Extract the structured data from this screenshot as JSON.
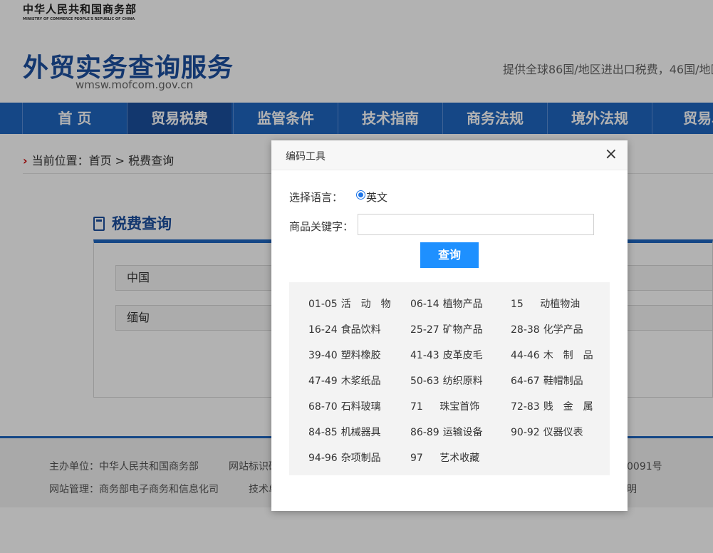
{
  "top": {
    "ministry_cn": "中华人民共和国商务部",
    "ministry_en": "MINISTRY OF COMMERCE PEOPLE'S REPUBLIC OF CHINA"
  },
  "header": {
    "title": "外贸实务查询服务",
    "url": "wmsw.mofcom.gov.cn",
    "slogan": "提供全球86国/地区进出口税费，46国/地区"
  },
  "nav": {
    "items": [
      "首 页",
      "贸易税费",
      "监管条件",
      "技术指南",
      "商务法规",
      "境外法规",
      "贸易单"
    ],
    "active_index": 1
  },
  "breadcrumb": {
    "text": "当前位置：首页 > 税费查询"
  },
  "tax": {
    "title": "税费查询",
    "field_from": "中国",
    "field_to": "缅甸"
  },
  "footer": {
    "row1_a": "主办单位：中华人民共和国商务部",
    "row1_b": "网站标识码",
    "row1_c": "0091号",
    "row2_a": "网站管理：商务部电子商务和信息化司",
    "row2_b": "技术单",
    "row2_c": "明"
  },
  "modal": {
    "title": "编码工具",
    "close": "×",
    "lang_label": "选择语言：",
    "lang_option": "英文",
    "keyword_label": "商品关键字：",
    "keyword_value": "",
    "query_button": "查询",
    "categories": [
      {
        "code": "01-05",
        "name": "活　动　物"
      },
      {
        "code": "06-14",
        "name": "植物产品"
      },
      {
        "code": "15",
        "name": "　  动植物油"
      },
      {
        "code": "16-24",
        "name": "食品饮料"
      },
      {
        "code": "25-27",
        "name": "矿物产品"
      },
      {
        "code": "28-38",
        "name": "化学产品"
      },
      {
        "code": "39-40",
        "name": "塑料橡胶"
      },
      {
        "code": "41-43",
        "name": "皮革皮毛"
      },
      {
        "code": "44-46",
        "name": "木　制　品"
      },
      {
        "code": "47-49",
        "name": "木浆纸品"
      },
      {
        "code": "50-63",
        "name": "纺织原料"
      },
      {
        "code": "64-67",
        "name": "鞋帽制品"
      },
      {
        "code": "68-70",
        "name": "石料玻璃"
      },
      {
        "code": "71",
        "name": "　  珠宝首饰"
      },
      {
        "code": "72-83",
        "name": "贱　金　属"
      },
      {
        "code": "84-85",
        "name": "机械器具"
      },
      {
        "code": "86-89",
        "name": "运输设备"
      },
      {
        "code": "90-92",
        "name": "仪器仪表"
      },
      {
        "code": "94-96",
        "name": "杂项制品"
      },
      {
        "code": "97",
        "name": "　  艺术收藏"
      }
    ]
  }
}
